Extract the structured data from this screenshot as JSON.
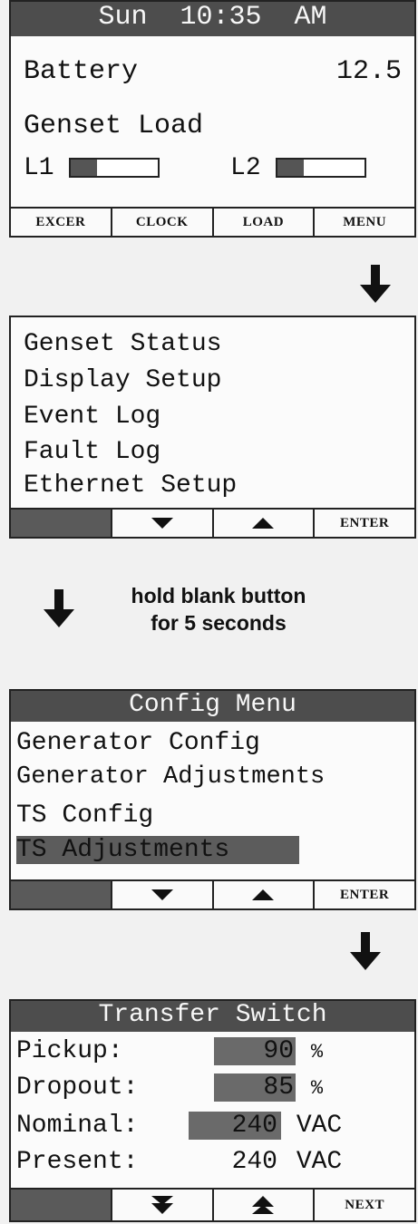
{
  "home": {
    "header": "Sun  10:35  AM",
    "battery_label": "Battery",
    "battery_value": "12.5",
    "genset_load_label": "Genset Load",
    "l1_label": "L1",
    "l1_level": 0.3,
    "l2_label": "L2",
    "l2_level": 0.3,
    "softkeys": [
      "EXCER",
      "CLOCK",
      "LOAD",
      "MENU"
    ]
  },
  "menu": {
    "items": [
      "Genset Status",
      "Display Setup",
      "Event Log",
      "Fault Log",
      "Ethernet Setup"
    ],
    "enter_label": "ENTER"
  },
  "instruction": {
    "line1": "hold blank button",
    "line2": "for 5 seconds"
  },
  "config_menu": {
    "header": "Config Menu",
    "items": [
      "Generator Config",
      "Generator Adjustments",
      "TS Config",
      "TS Adjustments"
    ],
    "selected_index": 3,
    "enter_label": "ENTER"
  },
  "transfer_switch": {
    "header": "Transfer Switch",
    "pickup_label": "Pickup:",
    "pickup_value": "90",
    "pickup_unit": "%",
    "dropout_label": "Dropout:",
    "dropout_value": "85",
    "dropout_unit": "%",
    "nominal_label": "Nominal:",
    "nominal_value": "240",
    "nominal_unit": "VAC",
    "present_label": "Present:",
    "present_value": "240",
    "present_unit": "VAC",
    "next_label": "NEXT"
  },
  "icons": {
    "flow_arrow": "arrow-down-icon",
    "softkey_down": "triangle-down-icon",
    "softkey_up": "triangle-up-icon"
  },
  "colors": {
    "header_bg": "#4d4d4d",
    "highlight": "#5c5c5c",
    "background": "#f1f1f1"
  }
}
